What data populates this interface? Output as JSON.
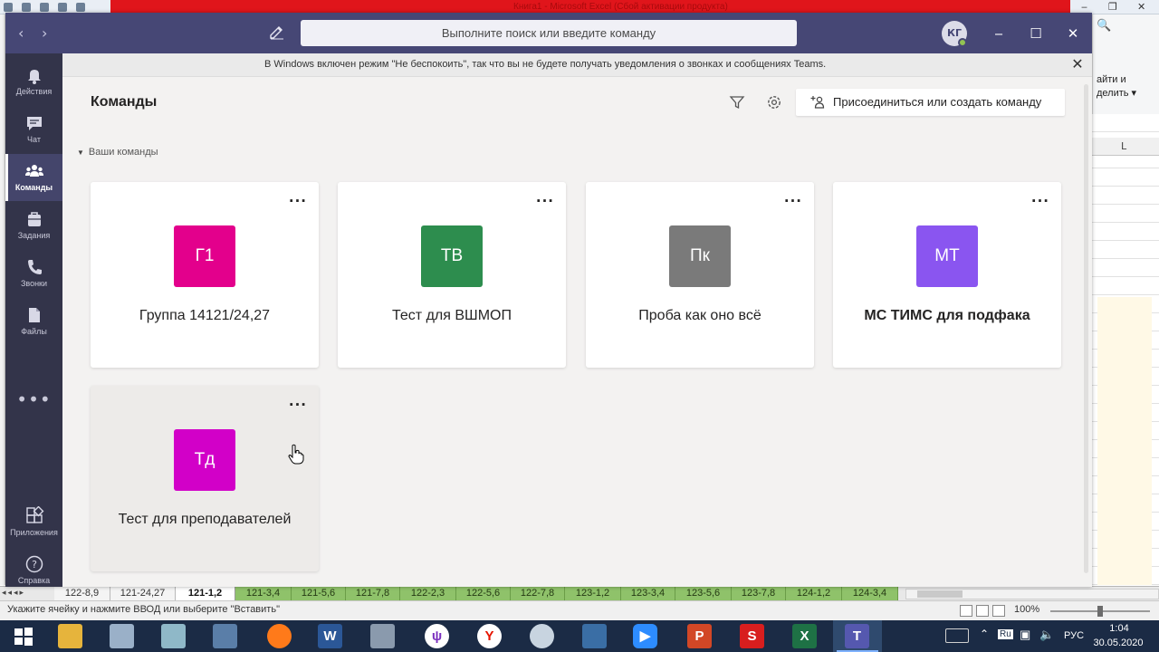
{
  "excel": {
    "title": "Книга1 - Microsoft Excel (Сбой активации продукта)",
    "ribbon_right": [
      "айти и",
      "делить ▾"
    ],
    "column_letter": "L",
    "status_text": "Укажите ячейку и нажмите ВВОД или выберите \"Вставить\"",
    "zoom": "100%",
    "sheet_tabs": [
      {
        "label": "122-8,9",
        "style": "plain"
      },
      {
        "label": "121-24,27",
        "style": "plain"
      },
      {
        "label": "121-1,2",
        "style": "active"
      },
      {
        "label": "121-3,4",
        "style": "green"
      },
      {
        "label": "121-5,6",
        "style": "green"
      },
      {
        "label": "121-7,8",
        "style": "green"
      },
      {
        "label": "122-2,3",
        "style": "green"
      },
      {
        "label": "122-5,6",
        "style": "green"
      },
      {
        "label": "122-7,8",
        "style": "green"
      },
      {
        "label": "123-1,2",
        "style": "green"
      },
      {
        "label": "123-3,4",
        "style": "green"
      },
      {
        "label": "123-5,6",
        "style": "green"
      },
      {
        "label": "123-7,8",
        "style": "green"
      },
      {
        "label": "124-1,2",
        "style": "green"
      },
      {
        "label": "124-3,4",
        "style": "green"
      }
    ]
  },
  "teams": {
    "search_placeholder": "Выполните поиск или введите команду",
    "user_initials": "КГ",
    "dnd_banner": "В Windows включен режим \"Не беспокоить\", так что вы не будете получать уведомления о звонках и сообщениях Teams.",
    "rail": [
      {
        "label": "Действия",
        "icon": "bell-icon"
      },
      {
        "label": "Чат",
        "icon": "chat-icon"
      },
      {
        "label": "Команды",
        "icon": "teams-icon",
        "active": true
      },
      {
        "label": "Задания",
        "icon": "assignments-icon"
      },
      {
        "label": "Звонки",
        "icon": "phone-icon"
      },
      {
        "label": "Файлы",
        "icon": "files-icon"
      }
    ],
    "rail_bottom": [
      {
        "label": "Приложения",
        "icon": "apps-icon"
      },
      {
        "label": "Справка",
        "icon": "help-icon"
      }
    ],
    "page_title": "Команды",
    "join_button": "Присоединиться или создать команду",
    "section_label": "Ваши команды",
    "teams_list": [
      {
        "initials": "Г1",
        "name": "Группа 14121/24,27",
        "color": "#e3008c"
      },
      {
        "initials": "ТВ",
        "name": "Тест для ВШМОП",
        "color": "#2d8d4e"
      },
      {
        "initials": "Пк",
        "name": "Проба как оно всё",
        "color": "#7a7a7a"
      },
      {
        "initials": "МТ",
        "name": "МС ТИМС для подфака",
        "color": "#8a55f0",
        "bold": true
      },
      {
        "initials": "Тд",
        "name": "Тест для преподавателей",
        "color": "#d200c8",
        "hover": true
      }
    ]
  },
  "taskbar": {
    "items": [
      "start",
      "explorer",
      "computer",
      "notes",
      "monitor",
      "firefox",
      "word",
      "calculator",
      "usb",
      "yandex",
      "paint",
      "network",
      "zoom",
      "powerpoint",
      "s-app",
      "excel",
      "teams"
    ],
    "tray": {
      "ime": "Ru",
      "lang": "РУС",
      "time": "1:04",
      "date": "30.05.2020"
    }
  }
}
